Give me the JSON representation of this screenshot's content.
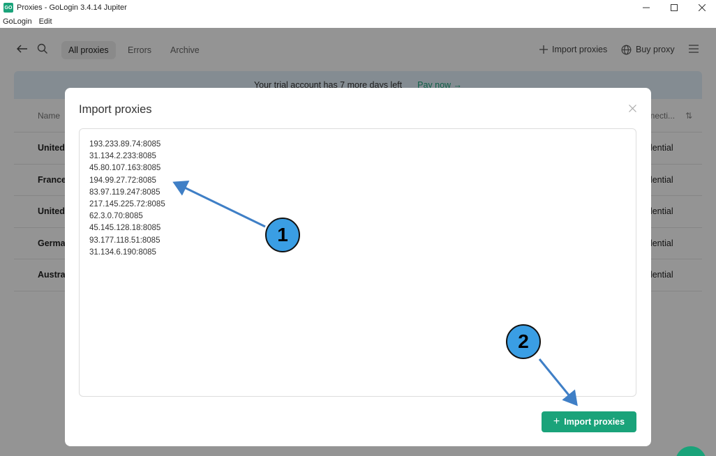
{
  "window": {
    "logo_text": "GO",
    "title": "Proxies - GoLogin 3.4.14 Jupiter"
  },
  "menu": [
    "GoLogin",
    "Edit"
  ],
  "toolbar": {
    "tabs": [
      {
        "label": "All proxies",
        "active": true
      },
      {
        "label": "Errors",
        "active": false
      },
      {
        "label": "Archive",
        "active": false
      }
    ],
    "import_label": "Import proxies",
    "buy_label": "Buy proxy"
  },
  "banner": {
    "text": "Your trial account has 7 more days left",
    "link": "Pay now →"
  },
  "table": {
    "name_header": "Name",
    "connection_header": "nnecti...",
    "rows": [
      {
        "name": "United",
        "connection": "idential"
      },
      {
        "name": "France",
        "connection": "idential"
      },
      {
        "name": "United",
        "connection": "idential"
      },
      {
        "name": "German",
        "connection": "idential"
      },
      {
        "name": "Austral",
        "connection": "idential"
      }
    ]
  },
  "modal": {
    "title": "Import proxies",
    "proxies": [
      "193.233.89.74:8085",
      "31.134.2.233:8085",
      "45.80.107.163:8085",
      "194.99.27.72:8085",
      "83.97.119.247:8085",
      "217.145.225.72:8085",
      "62.3.0.70:8085",
      "45.145.128.18:8085",
      "93.177.118.51:8085",
      "31.134.6.190:8085"
    ],
    "import_button_label": "Import proxies"
  },
  "annotations": {
    "badge_1": "1",
    "badge_2": "2",
    "badge_color": "#3a9ee4",
    "arrow_color": "#3f7fc6"
  },
  "colors": {
    "accent": "#1aa37a",
    "banner_bg": "#e4f1fb"
  }
}
